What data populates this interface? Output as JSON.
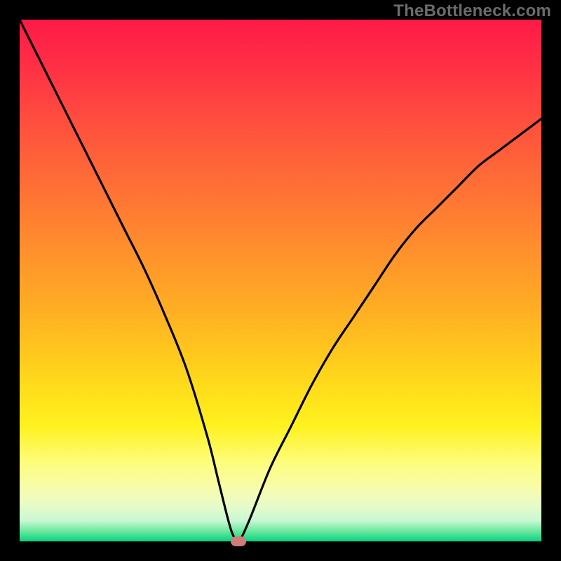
{
  "watermark": "TheBottleneck.com",
  "chart_data": {
    "type": "line",
    "title": "",
    "xlabel": "",
    "ylabel": "",
    "xlim": [
      0,
      100
    ],
    "ylim": [
      0,
      100
    ],
    "grid": false,
    "series": [
      {
        "name": "bottleneck-curve",
        "x": [
          0,
          4,
          8,
          12,
          16,
          20,
          24,
          28,
          32,
          36,
          38,
          40,
          41,
          42,
          44,
          48,
          52,
          56,
          60,
          64,
          68,
          72,
          76,
          80,
          84,
          88,
          92,
          96,
          100
        ],
        "values": [
          100,
          92,
          84,
          76,
          68,
          60,
          52,
          43,
          33,
          20,
          12,
          4,
          1,
          0,
          4,
          14,
          22,
          30,
          37,
          43,
          49,
          55,
          60,
          64,
          68,
          72,
          75,
          78,
          81
        ]
      }
    ],
    "marker": {
      "x": 42,
      "y": 0,
      "color": "#d47a7a"
    },
    "background_gradient": {
      "top": "#ff1a47",
      "bottom": "#07d27e"
    }
  }
}
